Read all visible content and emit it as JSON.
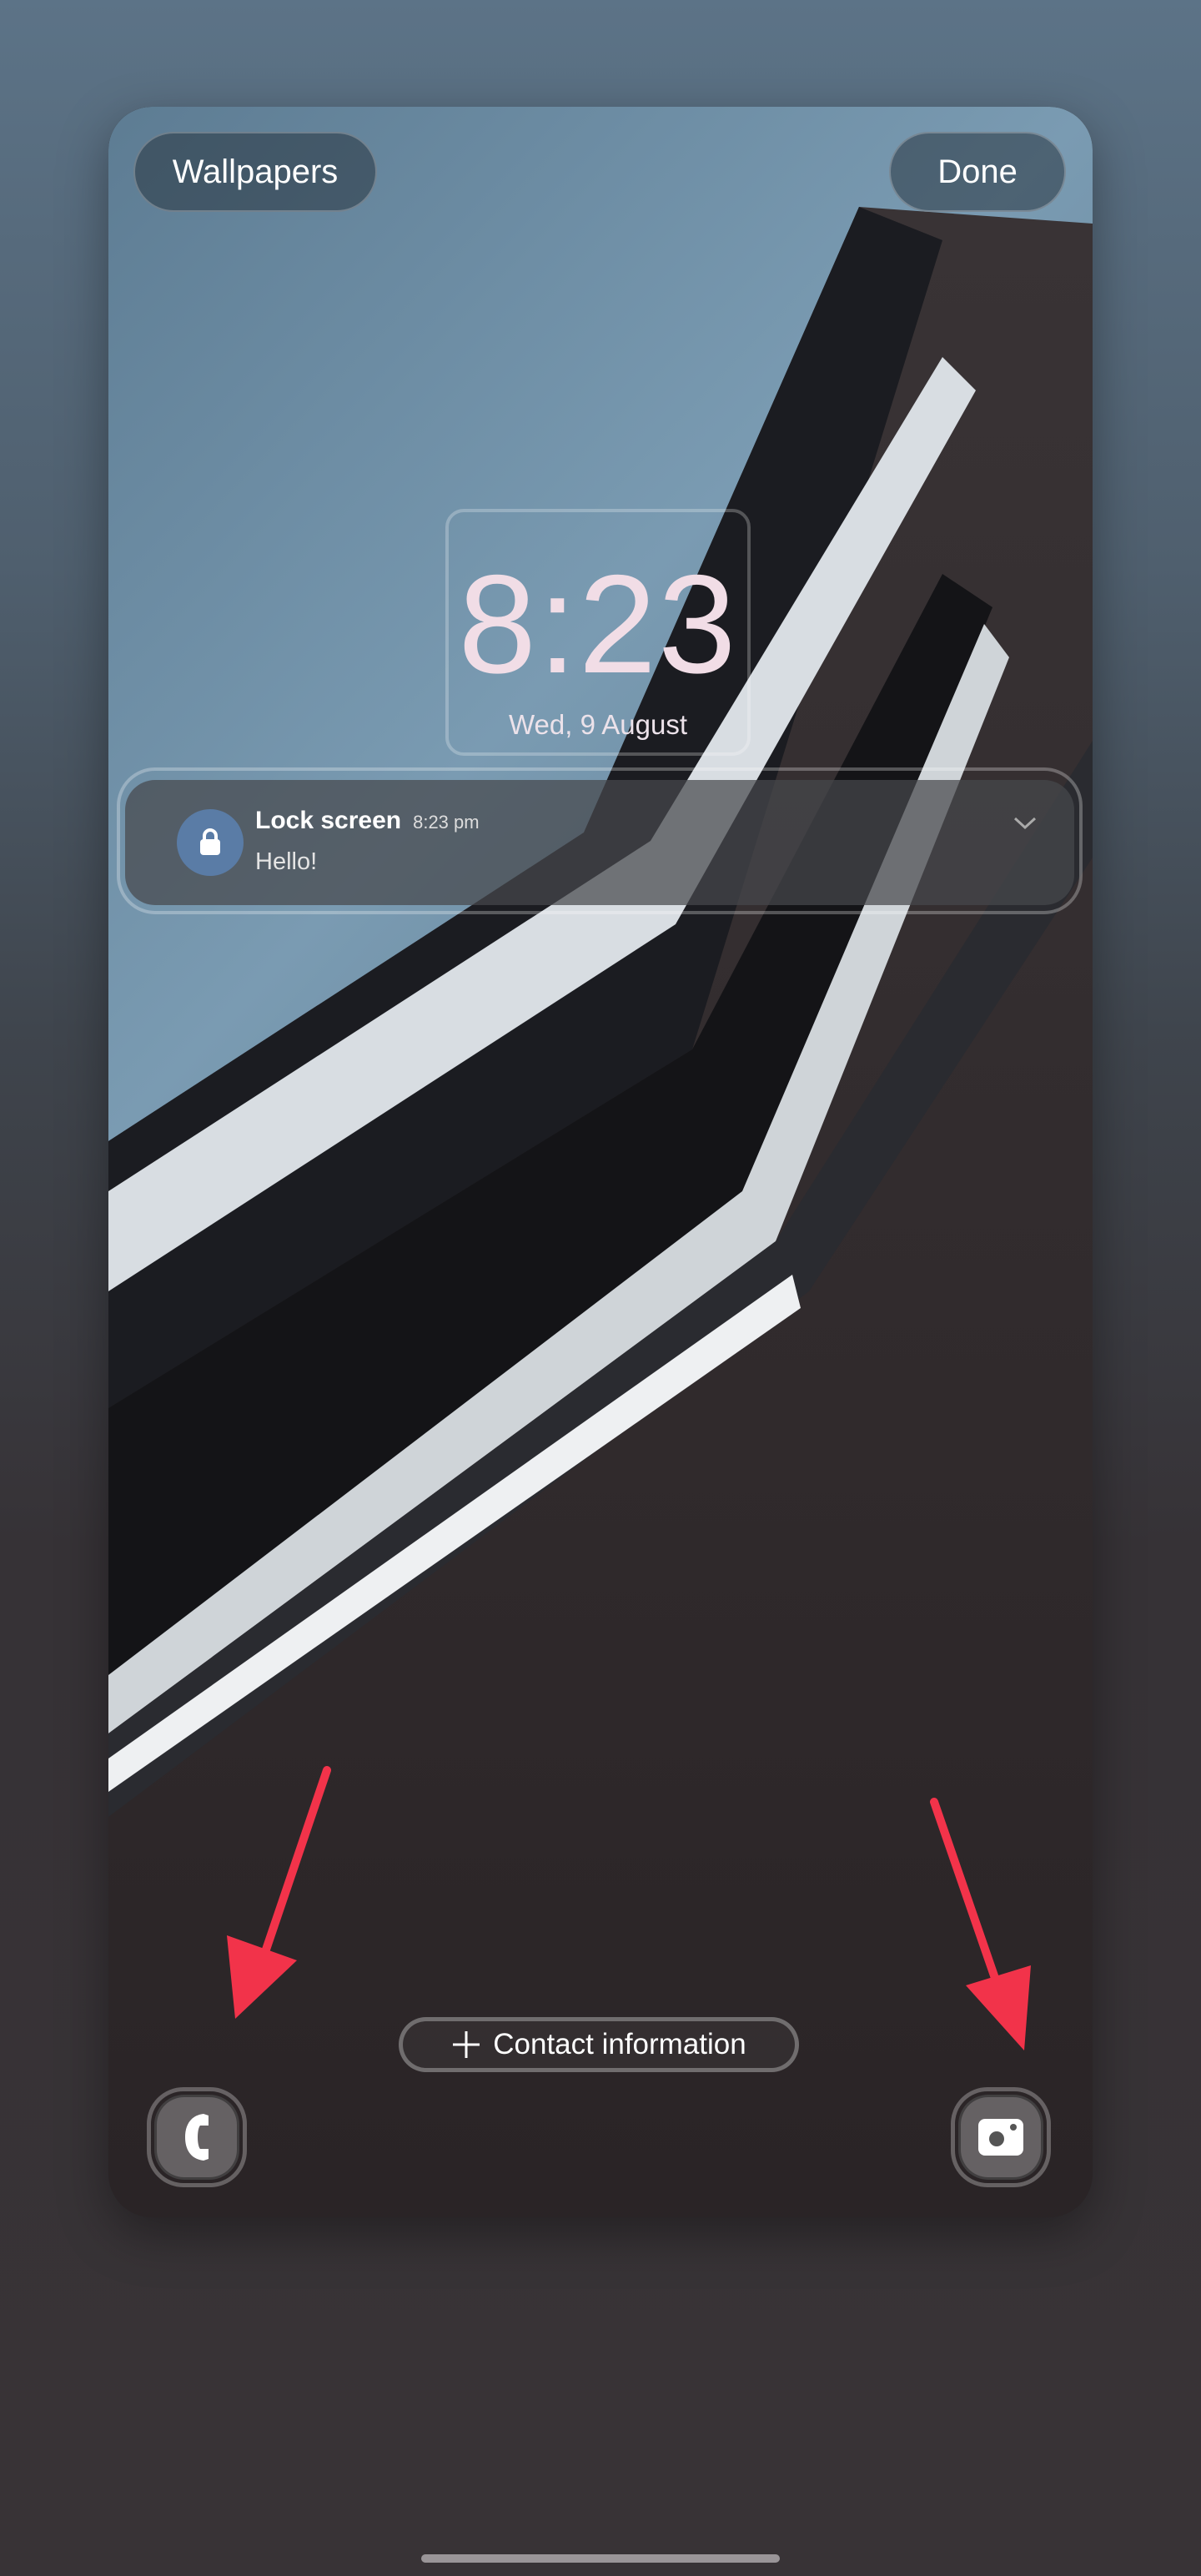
{
  "header": {
    "wallpapers_label": "Wallpapers",
    "done_label": "Done"
  },
  "clock": {
    "time": "8:23",
    "date": "Wed, 9 August",
    "color": "#f1dde6"
  },
  "notification": {
    "app": "Lock screen",
    "time": "8:23 pm",
    "message": "Hello!",
    "icon": "lock-icon",
    "expand_icon": "chevron-down-icon"
  },
  "contact": {
    "label": "Contact information",
    "icon": "plus-icon"
  },
  "shortcuts": {
    "left": "phone-icon",
    "right": "camera-icon"
  },
  "annotations": {
    "arrow_color": "#f2334a"
  }
}
